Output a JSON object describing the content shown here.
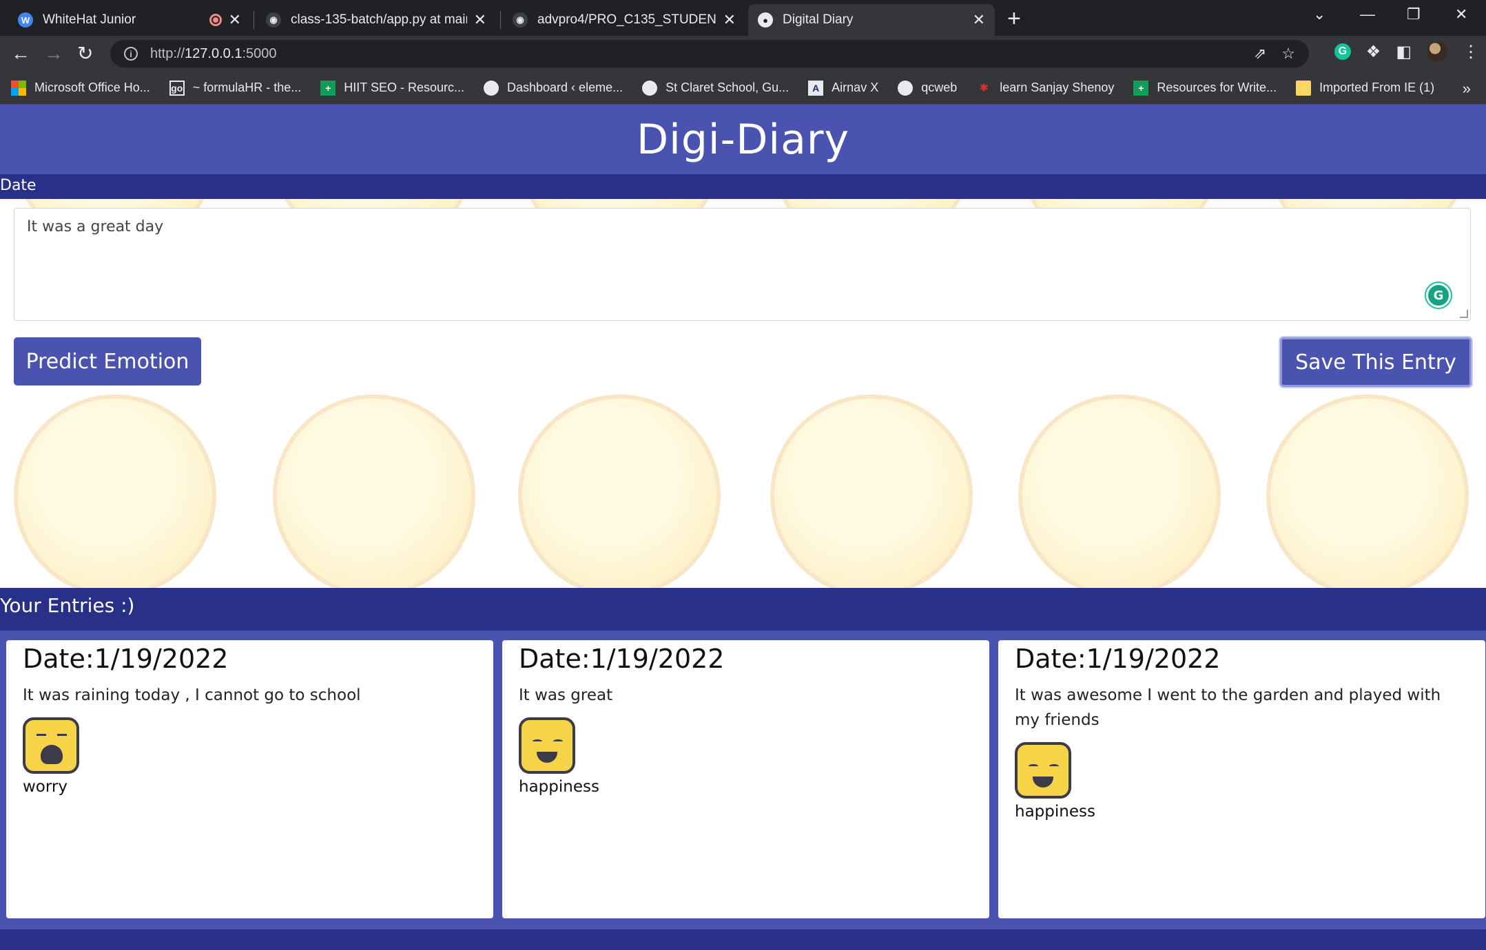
{
  "browser": {
    "tabs": [
      {
        "title": "WhiteHat Junior",
        "active": false
      },
      {
        "title": "class-135-batch/app.py at main ·",
        "active": false
      },
      {
        "title": "advpro4/PRO_C135_STUDENT_B",
        "active": false
      },
      {
        "title": "Digital Diary",
        "active": true
      }
    ],
    "close_glyph": "✕",
    "new_tab_glyph": "+",
    "url_scheme": "http://",
    "url_host": "127.0.0.1",
    "url_port": ":5000",
    "bookmarks": [
      {
        "label": "Microsoft Office Ho...",
        "icon": "microsoft-icon"
      },
      {
        "label": "~ formulaHR - the...",
        "icon": "go-icon"
      },
      {
        "label": "HIIT SEO - Resourc...",
        "icon": "sheets-icon"
      },
      {
        "label": "Dashboard ‹ eleme...",
        "icon": "globe-icon"
      },
      {
        "label": "St Claret School, Gu...",
        "icon": "globe-icon"
      },
      {
        "label": "Airnav X",
        "icon": "airnav-icon"
      },
      {
        "label": "qcweb",
        "icon": "globe-icon"
      },
      {
        "label": "learn Sanjay Shenoy",
        "icon": "learn-icon"
      },
      {
        "label": "Resources for Write...",
        "icon": "sheets-icon"
      },
      {
        "label": "Imported From IE (1)",
        "icon": "folder-icon"
      }
    ],
    "more_bookmarks": "»"
  },
  "app": {
    "title": "Digi-Diary",
    "date_label": "Date",
    "entry_text": "It was a great day",
    "predict_button": "Predict Emotion",
    "save_button": "Save This Entry",
    "entries_heading": "Your Entries :)",
    "grammarly_glyph": "G"
  },
  "entries": [
    {
      "date": "Date:1/19/2022",
      "text": "It was raining today , I cannot go to school",
      "emotion": "worry"
    },
    {
      "date": "Date:1/19/2022",
      "text": "It was great",
      "emotion": "happiness"
    },
    {
      "date": "Date:1/19/2022",
      "text": "It was awesome I went to the garden and played with my friends",
      "emotion": "happiness"
    }
  ],
  "colors": {
    "header": "#4b53b0",
    "bar": "#283187",
    "chrome_dark": "#202124",
    "chrome": "#35363a"
  }
}
